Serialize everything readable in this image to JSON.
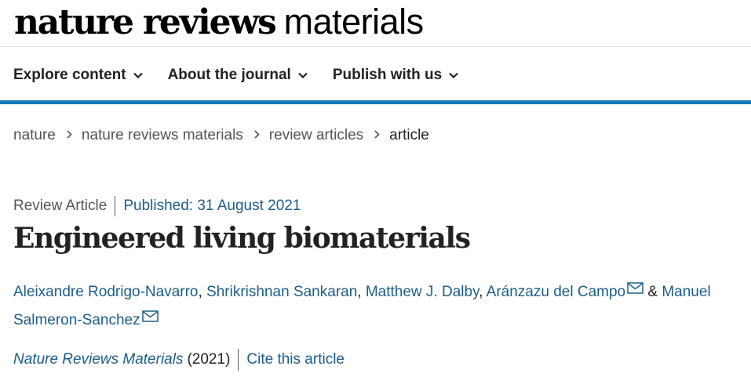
{
  "header": {
    "brand_bold": "nature reviews",
    "brand_light": "materials"
  },
  "nav": {
    "items": [
      {
        "label": "Explore content"
      },
      {
        "label": "About the journal"
      },
      {
        "label": "Publish with us"
      }
    ]
  },
  "breadcrumb": {
    "items": [
      "nature",
      "nature reviews materials",
      "review articles",
      "article"
    ]
  },
  "article": {
    "type": "Review Article",
    "published": "Published: 31 August 2021",
    "title": "Engineered living biomaterials",
    "authors": [
      "Aleixandre Rodrigo-Navarro",
      "Shrikrishnan Sankaran",
      "Matthew J. Dalby",
      "Aránzazu del Campo",
      "Manuel Salmeron-Sanchez"
    ],
    "separator_comma": ", ",
    "separator_and": " & ",
    "journal_name": "Nature Reviews Materials",
    "journal_year": "(2021)",
    "cite_label": "Cite this article"
  },
  "colors": {
    "accent_blue": "#0f79ba",
    "link": "#1c5d8c",
    "text": "#222222",
    "muted": "#555555"
  },
  "icons": {
    "nav_chevron": "chevron-down-icon",
    "breadcrumb_separator": "chevron-right-icon",
    "author_contact": "mail-icon"
  }
}
